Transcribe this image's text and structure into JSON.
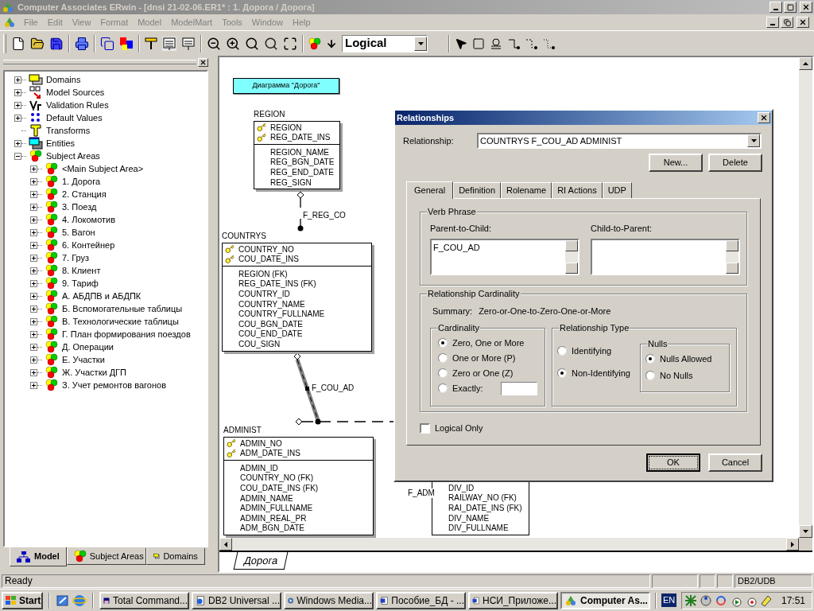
{
  "window": {
    "title": "Computer Associates ERwin - [dnsi 21-02-06.ER1* : 1. Дорога / Дорога]"
  },
  "menu": [
    {
      "label": "File"
    },
    {
      "label": "Edit"
    },
    {
      "label": "View"
    },
    {
      "label": "Format"
    },
    {
      "label": "Model"
    },
    {
      "label": "ModelMart"
    },
    {
      "label": "Tools"
    },
    {
      "label": "Window"
    },
    {
      "label": "Help"
    }
  ],
  "toolbar": {
    "view_mode": "Logical"
  },
  "tree": [
    {
      "label": "Domains",
      "kind": "domains",
      "expanded": false
    },
    {
      "label": "Model Sources",
      "kind": "sources",
      "expanded": false
    },
    {
      "label": "Validation Rules",
      "kind": "rules",
      "expanded": false
    },
    {
      "label": "Default Values",
      "kind": "defaults",
      "expanded": false
    },
    {
      "label": "Transforms",
      "kind": "transforms"
    },
    {
      "label": "Entities",
      "kind": "entities",
      "expanded": false
    },
    {
      "label": "Subject Areas",
      "kind": "subject",
      "expanded": true,
      "children": [
        {
          "label": "<Main Subject Area>",
          "kind": "subject",
          "expanded": false
        },
        {
          "label": "1. Дорога",
          "kind": "subject",
          "expanded": false
        },
        {
          "label": "2. Станция",
          "kind": "subject",
          "expanded": false
        },
        {
          "label": "3. Поезд",
          "kind": "subject",
          "expanded": false
        },
        {
          "label": "4. Локомотив",
          "kind": "subject",
          "expanded": false
        },
        {
          "label": "5. Вагон",
          "kind": "subject",
          "expanded": false
        },
        {
          "label": "6. Контейнер",
          "kind": "subject",
          "expanded": false
        },
        {
          "label": "7. Груз",
          "kind": "subject",
          "expanded": false
        },
        {
          "label": "8. Клиент",
          "kind": "subject",
          "expanded": false
        },
        {
          "label": "9. Тариф",
          "kind": "subject",
          "expanded": false
        },
        {
          "label": "А. АБДПВ и АБДПК",
          "kind": "subject",
          "expanded": false
        },
        {
          "label": "Б. Вспомогательные таблицы",
          "kind": "subject",
          "expanded": false
        },
        {
          "label": "В. Технологические таблицы",
          "kind": "subject",
          "expanded": false
        },
        {
          "label": "Г. План формирования поездов",
          "kind": "subject",
          "expanded": false
        },
        {
          "label": "Д. Операции",
          "kind": "subject",
          "expanded": false
        },
        {
          "label": "Е. Участки",
          "kind": "subject",
          "expanded": false
        },
        {
          "label": "Ж. Участки ДГП",
          "kind": "subject",
          "expanded": false
        },
        {
          "label": "З. Учет ремонтов вагонов",
          "kind": "subject",
          "expanded": false
        }
      ]
    }
  ],
  "left_tabs": [
    {
      "label": "Model",
      "kind": "model",
      "selected": true
    },
    {
      "label": "Subject Areas",
      "kind": "subject",
      "selected": false
    },
    {
      "label": "Domains",
      "kind": "domains",
      "selected": false
    }
  ],
  "diagram": {
    "title": "Диаграмма \"Дорога\"",
    "entities": [
      {
        "name": "REGION",
        "keys": [
          "REGION",
          "REG_DATE_INS"
        ],
        "attributes": [
          "REGION_NAME",
          "REG_BGN_DATE",
          "REG_END_DATE",
          "REG_SIGN"
        ]
      },
      {
        "name": "COUNTRYS",
        "keys": [
          "COUNTRY_NO",
          "COU_DATE_INS"
        ],
        "attributes": [
          "REGION (FK)",
          "REG_DATE_INS (FK)",
          "COUNTRY_ID",
          "COUNTRY_NAME",
          "COUNTRY_FULLNAME",
          "COU_BGN_DATE",
          "COU_END_DATE",
          "COU_SIGN"
        ]
      },
      {
        "name": "ADMINIST",
        "keys": [
          "ADMIN_NO",
          "ADM_DATE_INS"
        ],
        "attributes": [
          "ADMIN_ID",
          "COUNTRY_NO (FK)",
          "COU_DATE_INS (FK)",
          "ADMIN_NAME",
          "ADMIN_FULLNAME",
          "ADMIN_REAL_PR",
          "ADM_BGN_DATE"
        ]
      },
      {
        "attributes": [
          "DIV_ID",
          "RAILWAY_NO (FK)",
          "RAI_DATE_INS (FK)",
          "DIV_NAME",
          "DIV_FULLNAME"
        ]
      }
    ],
    "relationships": [
      {
        "label": "F_REG_CO",
        "selected": false
      },
      {
        "label": "F_COU_AD",
        "selected": true
      },
      {
        "label": "F_ADM",
        "selected": false
      }
    ],
    "tab": "Дорога"
  },
  "dialog": {
    "title": "Relationships",
    "relationship_label": "Relationship:",
    "relationship": "COUNTRYS F_COU_AD ADMINIST",
    "buttons": [
      "New...",
      "Delete"
    ],
    "tabs": [
      {
        "label": "General",
        "selected": true
      },
      {
        "label": "Definition",
        "selected": false
      },
      {
        "label": "Rolename",
        "selected": false
      },
      {
        "label": "RI Actions",
        "selected": false
      },
      {
        "label": "UDP",
        "selected": false
      }
    ],
    "verb_phrase": {
      "title": "Verb Phrase",
      "parent_label": "Parent-to-Child:",
      "parent_value": "F_COU_AD",
      "child_label": "Child-to-Parent:"
    },
    "cardinality_group": {
      "title": "Relationship Cardinality",
      "summary_label": "Summary:",
      "summary": "Zero-or-One-to-Zero-One-or-More"
    },
    "cardinality": {
      "title": "Cardinality",
      "options": [
        {
          "label": "Zero, One or More",
          "kind": "plain",
          "selected": true
        },
        {
          "label": "One or More (P)",
          "kind": "plain",
          "selected": false
        },
        {
          "label": "Zero or One (Z)",
          "kind": "plain",
          "selected": false
        },
        {
          "label": "Exactly:",
          "kind": "with-field",
          "selected": false
        }
      ]
    },
    "relationship_type": {
      "title": "Relationship Type",
      "options": [
        {
          "label": "Identifying",
          "selected": false
        },
        {
          "label": "Non-Identifying",
          "selected": true
        }
      ]
    },
    "nulls": {
      "title": "Nulls",
      "options": [
        {
          "label": "Nulls Allowed",
          "selected": true
        },
        {
          "label": "No Nulls",
          "selected": false
        }
      ]
    },
    "logical_only": {
      "label": "Logical Only",
      "checked": false
    },
    "footer_buttons": [
      {
        "label": "OK",
        "default": true
      },
      {
        "label": "Cancel",
        "default": false
      }
    ]
  },
  "status_bar": {
    "text": "Ready",
    "database": "DB2/UDB"
  },
  "taskbar": {
    "start": "Start",
    "tasks": [
      {
        "label": "Total Command...",
        "kind": "disk",
        "selected": false
      },
      {
        "label": "DB2 Universal ...",
        "kind": "web",
        "selected": false
      },
      {
        "label": "Windows Media...",
        "kind": "media",
        "selected": false
      },
      {
        "label": "Пособие_БД - ...",
        "kind": "word",
        "selected": false
      },
      {
        "label": "НСИ_Приложе...",
        "kind": "word",
        "selected": false
      },
      {
        "label": "Computer As...",
        "kind": "erwin",
        "selected": true
      }
    ],
    "language": "EN",
    "clock": "17:51"
  }
}
